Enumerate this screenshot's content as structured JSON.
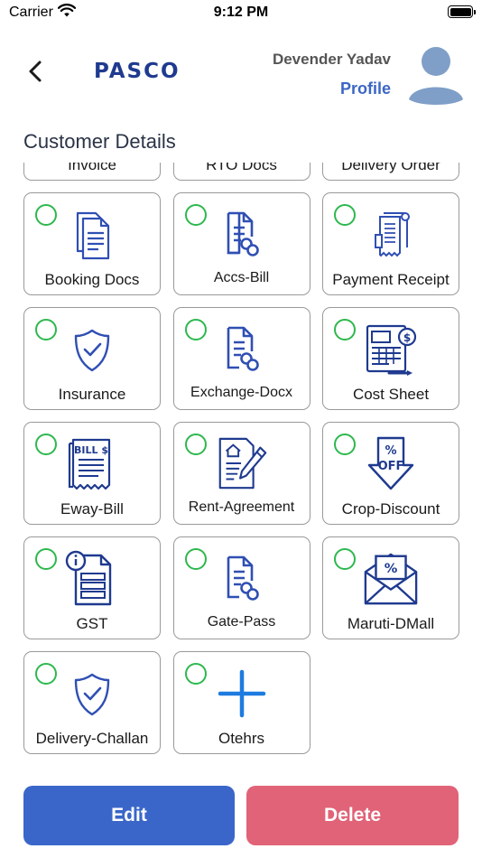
{
  "status_bar": {
    "carrier": "Carrier",
    "time": "9:12 PM"
  },
  "header": {
    "logo_text": "PASCO",
    "user_name": "Devender Yadav",
    "profile_label": "Profile"
  },
  "page": {
    "section_title": "Customer Details"
  },
  "documents": [
    {
      "label": "Invoice",
      "icon": "document-icon"
    },
    {
      "label": "RTO Docs",
      "icon": "document-icon"
    },
    {
      "label": "Delivery Order",
      "icon": "document-icon"
    },
    {
      "label": "Booking Docs",
      "icon": "documents-stack-icon"
    },
    {
      "label": "Accs-Bill",
      "icon": "file-link-icon"
    },
    {
      "label": "Payment Receipt",
      "icon": "receipt-icon"
    },
    {
      "label": "Insurance",
      "icon": "shield-check-icon"
    },
    {
      "label": "Exchange-Docx",
      "icon": "file-link-icon"
    },
    {
      "label": "Cost Sheet",
      "icon": "cost-sheet-icon"
    },
    {
      "label": "Eway-Bill",
      "icon": "bill-icon",
      "icon_text": "BILL $"
    },
    {
      "label": "Rent-Agreement",
      "icon": "agreement-icon"
    },
    {
      "label": "Crop-Discount",
      "icon": "discount-tag-icon",
      "icon_text": "OFF"
    },
    {
      "label": "GST",
      "icon": "info-document-icon"
    },
    {
      "label": "Gate-Pass",
      "icon": "file-link-icon"
    },
    {
      "label": "Maruti-DMall",
      "icon": "discount-envelope-icon"
    },
    {
      "label": "Delivery-Challan",
      "icon": "shield-check-icon"
    },
    {
      "label": "Otehrs",
      "icon": "plus-icon"
    }
  ],
  "actions": {
    "edit_label": "Edit",
    "delete_label": "Delete"
  },
  "colors": {
    "brand": "#1f3a8f",
    "icon_blue": "#2f4fb3",
    "radio_green": "#2db84d",
    "edit": "#3a66c9",
    "delete": "#e06377",
    "plus": "#1e7be0"
  }
}
